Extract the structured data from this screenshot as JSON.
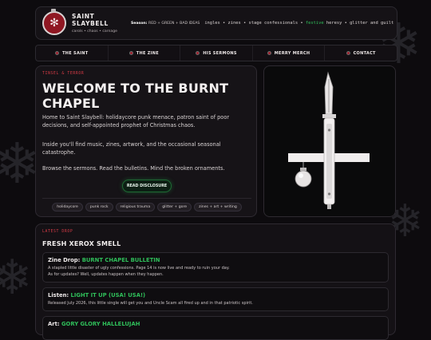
{
  "header": {
    "title": "SAINT SLAYBELL",
    "subtitle": "carols • chaos • carnage",
    "season_label": "Season:",
    "season_value": "RED + GREEN + BAD IDEAS",
    "ticker_a": "ingles • zines • stage confessionals • ",
    "ticker_b": "festive",
    "ticker_c": " heresy • glitter and guilt"
  },
  "nav": {
    "items": [
      "THE SAINT",
      "THE ZINE",
      "HIS SERMONS",
      "MERRY MERCH",
      "CONTACT"
    ]
  },
  "hero": {
    "kicker": "TINSEL & TERROR",
    "title": "WELCOME TO THE BURNT CHAPEL",
    "p1": "Home to Saint Slaybell: holidaycore punk menace, patron saint of poor decisions, and self-appointed prophet of Christmas chaos.",
    "p2": "Inside you'll find music, zines, artwork, and the occasional seasonal catastrophe.",
    "p3": "Browse the sermons. Read the bulletins. Mind the broken ornaments.",
    "button": "READ DISCLOSURE",
    "tags": [
      "holidaycore",
      "punk rock",
      "religious trauma",
      "glitter + gore",
      "zines + art + writing"
    ]
  },
  "drop": {
    "kicker": "LATEST DROP",
    "title": "FRESH XEROX SMELL",
    "cards": [
      {
        "label": "Zine Drop:",
        "title": "BURNT CHAPEL BULLETIN",
        "line1": "A stapled little disaster of ugly confessions. Page 14 is now live and ready to ruin your day.",
        "line2": "As for updates? Well, updates happen when they happen."
      },
      {
        "label": "Listen:",
        "title": "LIGHT IT UP (USA! USA!)",
        "line1": "Released July 2026, this little single will get you and Uncle Scam all fired up and in that patriotic spirit."
      },
      {
        "label": "Art:",
        "title": "GORY GLORY HALLELUJAH"
      }
    ]
  },
  "colors": {
    "accent_red": "#d33a45",
    "accent_green": "#2fbf5a",
    "background": "#0d0b0e"
  },
  "icons": {
    "logo": "snowflake-ornament-icon",
    "nav_bullet": "ornament-dot-icon",
    "decor": "snowflake-icon"
  }
}
